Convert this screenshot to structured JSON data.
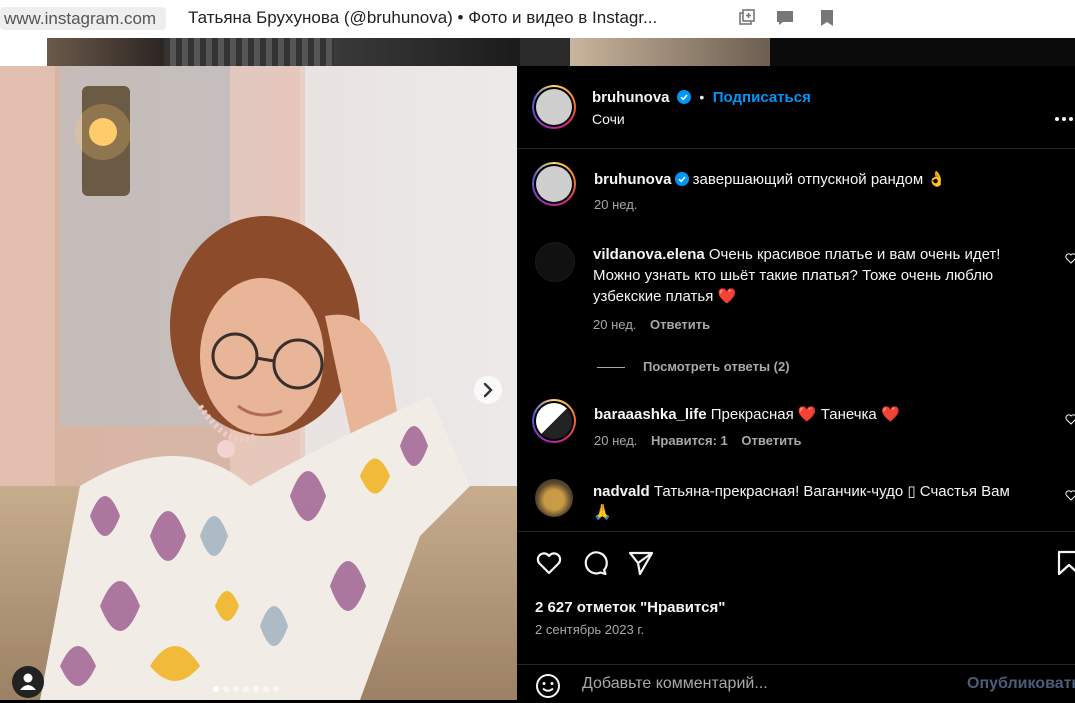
{
  "browser": {
    "url": "www.instagram.com",
    "tab_title": "Татьяна Брухунова (@bruhunova) • Фото и видео в Instagr..."
  },
  "post": {
    "author": "bruhunova",
    "follow_label": "Подписаться",
    "separator": "•",
    "location": "Сочи",
    "caption_text": "завершающий отпускной рандом 👌",
    "caption_time": "20 нед.",
    "nav_arrow": "›",
    "carousel_dots": 7,
    "carousel_active": 1
  },
  "comments": [
    {
      "user": "vildanova.elena",
      "text_line1": "Очень красивое платье и вам очень идет!",
      "text_line2": "Можно узнать кто шьёт такие платья?   Тоже очень люблю",
      "text_line3": "узбекские платья",
      "emoji": "❤️",
      "time": "20 нед.",
      "reply": "Ответить",
      "view_replies": "Посмотреть ответы (2)"
    },
    {
      "user": "baraaashka_life",
      "text": "Прекрасная",
      "emoji1": "❤️",
      "text2": "Танечка",
      "emoji2": "❤️",
      "time": "20 нед.",
      "likes": "Нравится: 1",
      "reply": "Ответить"
    },
    {
      "user": "nadvald",
      "text": "Татьяна-прекрасная! Ваганчик-чудо ",
      "box_glyph": "▯",
      "text_end": " Счастья Вам",
      "emoji": "🙏"
    }
  ],
  "footer": {
    "likes_count": "2 627 отметок \"Нравится\"",
    "date": "2 сентябрь 2023 г.",
    "add_comment_placeholder": "Добавьте комментарий...",
    "publish_label": "Опубликовать"
  },
  "icons": {
    "heart": "heart-icon",
    "comment": "comment-icon",
    "share": "share-icon",
    "save": "bookmark-icon",
    "emoji": "emoji-icon",
    "more": "more-icon",
    "verified": "verified-badge-icon"
  },
  "colors": {
    "accent": "#0095f6",
    "background": "#000000",
    "secondary_text": "#a8a8a8",
    "heart": "#ff3040"
  }
}
